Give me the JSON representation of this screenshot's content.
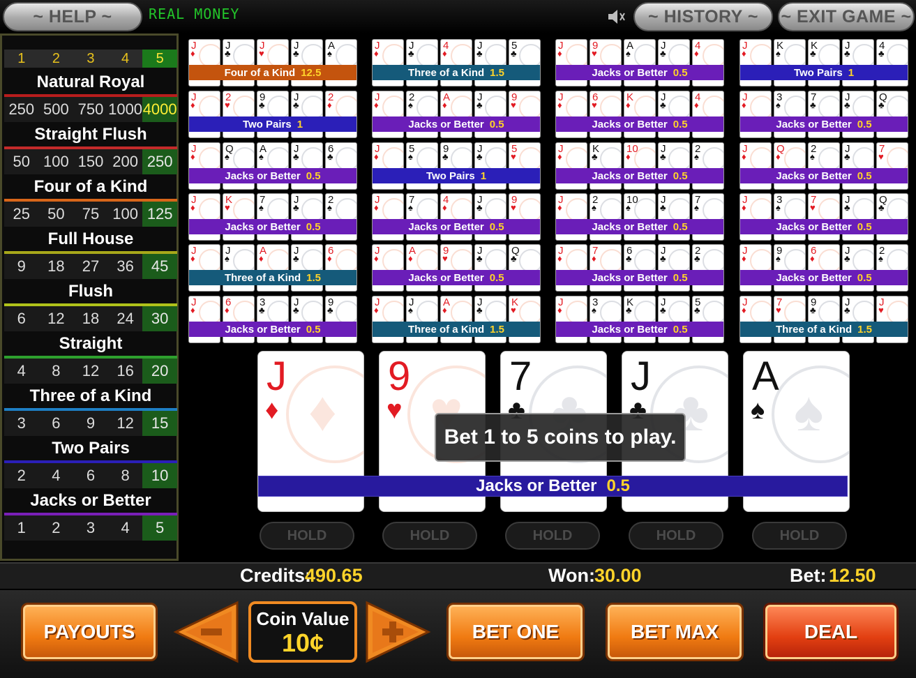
{
  "top": {
    "help_label": "~ HELP ~",
    "mode_label": "REAL MONEY",
    "history_label": "~ HISTORY ~",
    "exit_label": "~ EXIT GAME ~",
    "speaker_icon": "speaker-icon"
  },
  "paytable": {
    "coins": [
      "1",
      "2",
      "3",
      "4",
      "5"
    ],
    "active_coin_index": 4,
    "hands": [
      {
        "name": "Natural Royal",
        "line_color": "#b81d1d",
        "pays": [
          "250",
          "500",
          "750",
          "1000",
          "4000"
        ],
        "highlight": true
      },
      {
        "name": "Straight Flush",
        "line_color": "#c42a2a",
        "pays": [
          "50",
          "100",
          "150",
          "200",
          "250"
        ]
      },
      {
        "name": "Four of a Kind",
        "line_color": "#d8661a",
        "pays": [
          "25",
          "50",
          "75",
          "100",
          "125"
        ]
      },
      {
        "name": "Full House",
        "line_color": "#a8a81a",
        "pays": [
          "9",
          "18",
          "27",
          "36",
          "45"
        ]
      },
      {
        "name": "Flush",
        "line_color": "#b0c21a",
        "pays": [
          "6",
          "12",
          "18",
          "24",
          "30"
        ]
      },
      {
        "name": "Straight",
        "line_color": "#2ea02e",
        "pays": [
          "4",
          "8",
          "12",
          "16",
          "20"
        ]
      },
      {
        "name": "Three of a Kind",
        "line_color": "#1e7fc4",
        "pays": [
          "3",
          "6",
          "9",
          "12",
          "15"
        ]
      },
      {
        "name": "Two Pairs",
        "line_color": "#2b1fb8",
        "pays": [
          "2",
          "4",
          "6",
          "8",
          "10"
        ]
      },
      {
        "name": "Jacks or Better",
        "line_color": "#7a1fb8",
        "pays": [
          "1",
          "2",
          "3",
          "4",
          "5"
        ]
      }
    ]
  },
  "mini_hands": [
    {
      "cards": [
        [
          "J",
          "♦",
          "red"
        ],
        [
          "J",
          "♣",
          "blk"
        ],
        [
          "J",
          "♥",
          "red"
        ],
        [
          "J",
          "♣",
          "blk"
        ],
        [
          "A",
          "♠",
          "blk"
        ]
      ],
      "label": "Four of a Kind",
      "value": "12.5",
      "color": "#c4540e"
    },
    {
      "cards": [
        [
          "J",
          "♦",
          "red"
        ],
        [
          "J",
          "♣",
          "blk"
        ],
        [
          "4",
          "♦",
          "red"
        ],
        [
          "J",
          "♣",
          "blk"
        ],
        [
          "5",
          "♣",
          "blk"
        ]
      ],
      "label": "Three of a Kind",
      "value": "1.5",
      "color": "#155a7a"
    },
    {
      "cards": [
        [
          "J",
          "♦",
          "red"
        ],
        [
          "9",
          "♥",
          "red"
        ],
        [
          "A",
          "♠",
          "blk"
        ],
        [
          "J",
          "♣",
          "blk"
        ],
        [
          "4",
          "♦",
          "red"
        ]
      ],
      "label": "Jacks or Better",
      "value": "0.5",
      "color": "#6a1eb8"
    },
    {
      "cards": [
        [
          "J",
          "♦",
          "red"
        ],
        [
          "K",
          "♠",
          "blk"
        ],
        [
          "K",
          "♣",
          "blk"
        ],
        [
          "J",
          "♣",
          "blk"
        ],
        [
          "4",
          "♣",
          "blk"
        ]
      ],
      "label": "Two Pairs",
      "value": "1",
      "color": "#2b1fb8"
    },
    {
      "cards": [
        [
          "J",
          "♦",
          "red"
        ],
        [
          "2",
          "♥",
          "red"
        ],
        [
          "9",
          "♣",
          "blk"
        ],
        [
          "J",
          "♣",
          "blk"
        ],
        [
          "2",
          "♦",
          "red"
        ]
      ],
      "label": "Two Pairs",
      "value": "1",
      "color": "#2b1fb8"
    },
    {
      "cards": [
        [
          "J",
          "♦",
          "red"
        ],
        [
          "2",
          "♠",
          "blk"
        ],
        [
          "A",
          "♦",
          "red"
        ],
        [
          "J",
          "♣",
          "blk"
        ],
        [
          "9",
          "♥",
          "red"
        ]
      ],
      "label": "Jacks or Better",
      "value": "0.5",
      "color": "#6a1eb8"
    },
    {
      "cards": [
        [
          "J",
          "♦",
          "red"
        ],
        [
          "6",
          "♥",
          "red"
        ],
        [
          "K",
          "♦",
          "red"
        ],
        [
          "J",
          "♣",
          "blk"
        ],
        [
          "4",
          "♦",
          "red"
        ]
      ],
      "label": "Jacks or Better",
      "value": "0.5",
      "color": "#6a1eb8"
    },
    {
      "cards": [
        [
          "J",
          "♦",
          "red"
        ],
        [
          "3",
          "♠",
          "blk"
        ],
        [
          "7",
          "♣",
          "blk"
        ],
        [
          "J",
          "♣",
          "blk"
        ],
        [
          "Q",
          "♣",
          "blk"
        ]
      ],
      "label": "Jacks or Better",
      "value": "0.5",
      "color": "#6a1eb8"
    },
    {
      "cards": [
        [
          "J",
          "♦",
          "red"
        ],
        [
          "Q",
          "♠",
          "blk"
        ],
        [
          "A",
          "♠",
          "blk"
        ],
        [
          "J",
          "♣",
          "blk"
        ],
        [
          "6",
          "♣",
          "blk"
        ]
      ],
      "label": "Jacks or Better",
      "value": "0.5",
      "color": "#6a1eb8"
    },
    {
      "cards": [
        [
          "J",
          "♦",
          "red"
        ],
        [
          "5",
          "♠",
          "blk"
        ],
        [
          "9",
          "♣",
          "blk"
        ],
        [
          "J",
          "♣",
          "blk"
        ],
        [
          "5",
          "♥",
          "red"
        ]
      ],
      "label": "Two Pairs",
      "value": "1",
      "color": "#2b1fb8"
    },
    {
      "cards": [
        [
          "J",
          "♦",
          "red"
        ],
        [
          "K",
          "♣",
          "blk"
        ],
        [
          "10",
          "♦",
          "red"
        ],
        [
          "J",
          "♣",
          "blk"
        ],
        [
          "2",
          "♠",
          "blk"
        ]
      ],
      "label": "Jacks or Better",
      "value": "0.5",
      "color": "#6a1eb8"
    },
    {
      "cards": [
        [
          "J",
          "♦",
          "red"
        ],
        [
          "Q",
          "♦",
          "red"
        ],
        [
          "2",
          "♠",
          "blk"
        ],
        [
          "J",
          "♣",
          "blk"
        ],
        [
          "7",
          "♥",
          "red"
        ]
      ],
      "label": "Jacks or Better",
      "value": "0.5",
      "color": "#6a1eb8"
    },
    {
      "cards": [
        [
          "J",
          "♦",
          "red"
        ],
        [
          "K",
          "♥",
          "red"
        ],
        [
          "7",
          "♠",
          "blk"
        ],
        [
          "J",
          "♣",
          "blk"
        ],
        [
          "2",
          "♠",
          "blk"
        ]
      ],
      "label": "Jacks or Better",
      "value": "0.5",
      "color": "#6a1eb8"
    },
    {
      "cards": [
        [
          "J",
          "♦",
          "red"
        ],
        [
          "7",
          "♠",
          "blk"
        ],
        [
          "4",
          "♦",
          "red"
        ],
        [
          "J",
          "♣",
          "blk"
        ],
        [
          "9",
          "♥",
          "red"
        ]
      ],
      "label": "Jacks or Better",
      "value": "0.5",
      "color": "#6a1eb8"
    },
    {
      "cards": [
        [
          "J",
          "♦",
          "red"
        ],
        [
          "2",
          "♠",
          "blk"
        ],
        [
          "10",
          "♠",
          "blk"
        ],
        [
          "J",
          "♣",
          "blk"
        ],
        [
          "7",
          "♠",
          "blk"
        ]
      ],
      "label": "Jacks or Better",
      "value": "0.5",
      "color": "#6a1eb8"
    },
    {
      "cards": [
        [
          "J",
          "♦",
          "red"
        ],
        [
          "3",
          "♠",
          "blk"
        ],
        [
          "7",
          "♥",
          "red"
        ],
        [
          "J",
          "♣",
          "blk"
        ],
        [
          "Q",
          "♣",
          "blk"
        ]
      ],
      "label": "Jacks or Better",
      "value": "0.5",
      "color": "#6a1eb8"
    },
    {
      "cards": [
        [
          "J",
          "♦",
          "red"
        ],
        [
          "J",
          "♠",
          "blk"
        ],
        [
          "A",
          "♦",
          "red"
        ],
        [
          "J",
          "♣",
          "blk"
        ],
        [
          "6",
          "♦",
          "red"
        ]
      ],
      "label": "Three of a Kind",
      "value": "1.5",
      "color": "#155a7a"
    },
    {
      "cards": [
        [
          "J",
          "♦",
          "red"
        ],
        [
          "A",
          "♦",
          "red"
        ],
        [
          "9",
          "♥",
          "red"
        ],
        [
          "J",
          "♣",
          "blk"
        ],
        [
          "Q",
          "♣",
          "blk"
        ]
      ],
      "label": "Jacks or Better",
      "value": "0.5",
      "color": "#6a1eb8"
    },
    {
      "cards": [
        [
          "J",
          "♦",
          "red"
        ],
        [
          "7",
          "♦",
          "red"
        ],
        [
          "6",
          "♣",
          "blk"
        ],
        [
          "J",
          "♣",
          "blk"
        ],
        [
          "2",
          "♣",
          "blk"
        ]
      ],
      "label": "Jacks or Better",
      "value": "0.5",
      "color": "#6a1eb8"
    },
    {
      "cards": [
        [
          "J",
          "♦",
          "red"
        ],
        [
          "9",
          "♠",
          "blk"
        ],
        [
          "6",
          "♦",
          "red"
        ],
        [
          "J",
          "♣",
          "blk"
        ],
        [
          "2",
          "♠",
          "blk"
        ]
      ],
      "label": "Jacks or Better",
      "value": "0.5",
      "color": "#6a1eb8"
    },
    {
      "cards": [
        [
          "J",
          "♦",
          "red"
        ],
        [
          "6",
          "♦",
          "red"
        ],
        [
          "3",
          "♣",
          "blk"
        ],
        [
          "J",
          "♣",
          "blk"
        ],
        [
          "9",
          "♣",
          "blk"
        ]
      ],
      "label": "Jacks or Better",
      "value": "0.5",
      "color": "#6a1eb8"
    },
    {
      "cards": [
        [
          "J",
          "♦",
          "red"
        ],
        [
          "J",
          "♠",
          "blk"
        ],
        [
          "A",
          "♦",
          "red"
        ],
        [
          "J",
          "♣",
          "blk"
        ],
        [
          "K",
          "♥",
          "red"
        ]
      ],
      "label": "Three of a Kind",
      "value": "1.5",
      "color": "#155a7a"
    },
    {
      "cards": [
        [
          "J",
          "♦",
          "red"
        ],
        [
          "3",
          "♠",
          "blk"
        ],
        [
          "K",
          "♣",
          "blk"
        ],
        [
          "J",
          "♣",
          "blk"
        ],
        [
          "5",
          "♣",
          "blk"
        ]
      ],
      "label": "Jacks or Better",
      "value": "0.5",
      "color": "#6a1eb8"
    },
    {
      "cards": [
        [
          "J",
          "♦",
          "red"
        ],
        [
          "7",
          "♥",
          "red"
        ],
        [
          "9",
          "♣",
          "blk"
        ],
        [
          "J",
          "♣",
          "blk"
        ],
        [
          "J",
          "♥",
          "red"
        ]
      ],
      "label": "Three of a Kind",
      "value": "1.5",
      "color": "#155a7a"
    }
  ],
  "main_hand": {
    "cards": [
      {
        "rank": "J",
        "suit": "♦",
        "color": "red"
      },
      {
        "rank": "9",
        "suit": "♥",
        "color": "red"
      },
      {
        "rank": "7",
        "suit": "♣",
        "color": "blk"
      },
      {
        "rank": "J",
        "suit": "♣",
        "color": "blk"
      },
      {
        "rank": "A",
        "suit": "♠",
        "color": "blk"
      }
    ],
    "result_label": "Jacks or Better",
    "result_value": "0.5",
    "hold_label": "HOLD"
  },
  "message": "Bet 1 to 5 coins to play.",
  "status": {
    "credits_label": "Credits:",
    "credits_value": "490.65",
    "won_label": "Won:",
    "won_value": "30.00",
    "bet_label": "Bet:",
    "bet_value": "12.50"
  },
  "controls": {
    "payouts_label": "PAYOUTS",
    "coin_value_title": "Coin Value",
    "coin_value": "10¢",
    "bet_one_label": "BET ONE",
    "bet_max_label": "BET MAX",
    "deal_label": "DEAL"
  }
}
